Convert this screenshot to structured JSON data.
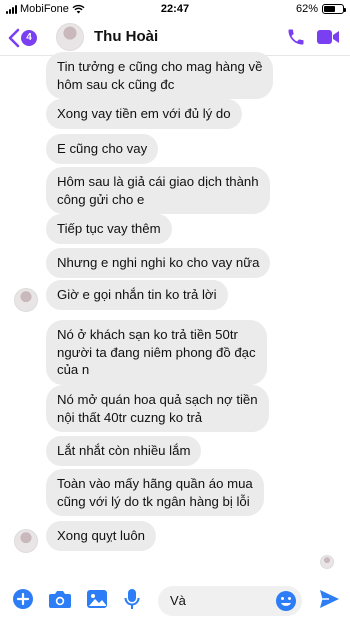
{
  "status": {
    "carrier": "MobiFone",
    "time": "22:47",
    "battery": "62%",
    "battery_level": 0.62
  },
  "header": {
    "unread_count": "4",
    "contact_name": "Thu Hoài"
  },
  "messages": [
    "Tin tưởng e cũng cho mag hàng về\nhôm sau ck cũng đc",
    "Xong vay tiền em với đủ lý do",
    "E cũng cho vay",
    "Hôm sau là giả cái giao dịch thành\ncông gửi cho e",
    "Tiếp tục vay thêm",
    "Nhưng e nghi nghi ko cho vay nữa",
    "Giờ e gọi nhắn tin ko trả lời",
    "Nó ở khách sạn ko trả tiền 50tr\nngười ta đang niêm phong đồ đạc\ncủa n",
    "Nó mở quán hoa quả sạch nợ tiền\nnội thất 40tr cuzng ko trả",
    "Lắt nhắt còn nhiều lắm",
    "Toàn vào mấy hãng quần áo mua\ncũng với lý do tk ngân hàng bị lỗi",
    "Xong quỵt luôn"
  ],
  "composer": {
    "input_value": "Và"
  },
  "colors": {
    "accent": "#7b3ff2",
    "composer_icons": "#2d7df6",
    "bubble": "#ebebeb"
  },
  "icons": [
    "back-chevron-icon",
    "phone-icon",
    "video-icon",
    "plus-icon",
    "camera-icon",
    "gallery-icon",
    "microphone-icon",
    "emoji-icon",
    "send-icon"
  ]
}
